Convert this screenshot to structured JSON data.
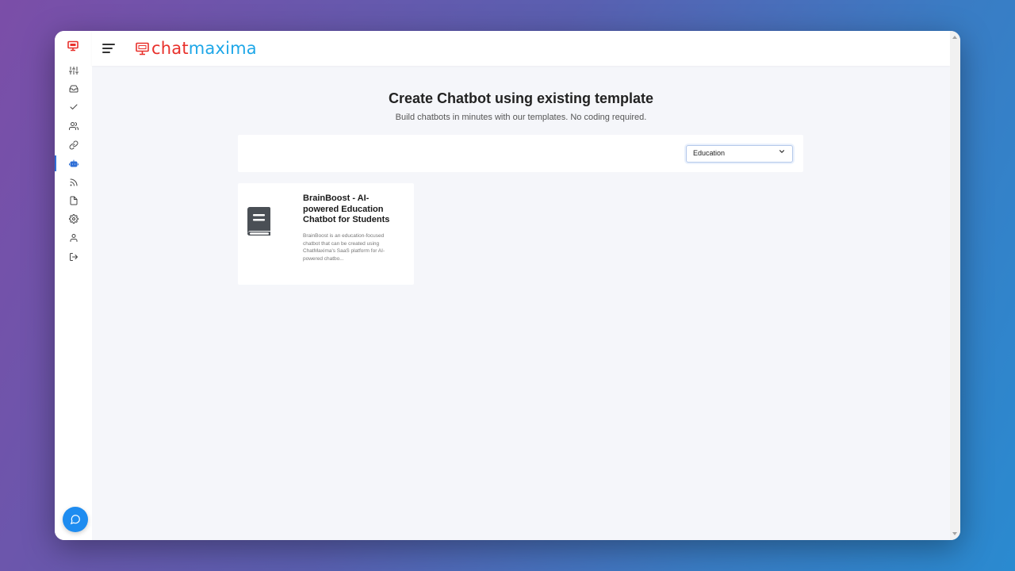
{
  "brand": {
    "part1": "chat",
    "part2": "maxima"
  },
  "sidebar": {
    "items": [
      {
        "name": "sliders-icon"
      },
      {
        "name": "inbox-icon"
      },
      {
        "name": "check-icon"
      },
      {
        "name": "users-icon"
      },
      {
        "name": "link-icon"
      },
      {
        "name": "bot-icon",
        "active": true
      },
      {
        "name": "rss-icon"
      },
      {
        "name": "file-icon"
      },
      {
        "name": "settings-icon"
      },
      {
        "name": "user-icon"
      },
      {
        "name": "logout-icon"
      }
    ]
  },
  "header": {
    "title": "Create Chatbot using existing template",
    "subtitle": "Build chatbots in minutes with our templates. No coding required."
  },
  "filter": {
    "selected": "Education"
  },
  "templates": [
    {
      "title": "BrainBoost - AI-powered Education Chatbot for Students",
      "description": "BrainBoost is an education-focused chatbot that can be created using ChatMaxima's SaaS platform for AI-powered chatbo..."
    }
  ],
  "colors": {
    "accent": "#2f6fd6",
    "brand_red": "#e8302b",
    "brand_blue": "#1ea7e8",
    "fab": "#1e8cf0"
  }
}
